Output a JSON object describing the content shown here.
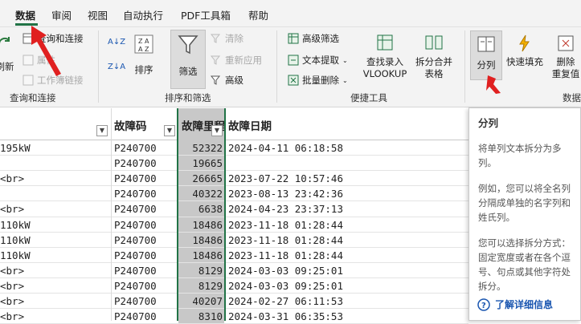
{
  "menu": {
    "tabs": [
      {
        "label": "数据",
        "active": true
      },
      {
        "label": "审阅"
      },
      {
        "label": "视图"
      },
      {
        "label": "自动执行"
      },
      {
        "label": "PDF工具箱"
      },
      {
        "label": "帮助"
      }
    ]
  },
  "ribbon": {
    "query_group": {
      "refresh_label": "刷新",
      "queries_connections_label": "查询和连接",
      "properties_label": "属性",
      "workbook_links_label": "工作簿链接",
      "group_label": "查询和连接"
    },
    "sort_filter_group": {
      "sort_az_label": "A↓Z",
      "sort_za_label": "Z↓A",
      "sort_label": "排序",
      "filter_label": "筛选",
      "clear_label": "清除",
      "reapply_label": "重新应用",
      "advanced_label": "高级",
      "group_label": "排序和筛选"
    },
    "tools_group": {
      "advanced_filter_label": "高级筛选",
      "text_extract_label": "文本提取",
      "batch_delete_label": "批量删除",
      "vlookup_label_line1": "查找录入",
      "vlookup_label_line2": "VLOOKUP",
      "split_merge_line1": "拆分合并",
      "split_merge_line2": "表格",
      "group_label": "便捷工具"
    },
    "data_tools_group": {
      "text_to_columns_label": "分列",
      "flash_fill_label": "快速填充",
      "remove_dup_line1": "删除",
      "remove_dup_line2": "重复值",
      "group_label": "数据"
    }
  },
  "sheet": {
    "headers": {
      "code": "故障码",
      "mileage": "故障里程",
      "date": "故障日期"
    },
    "rows": [
      {
        "a": "195kW",
        "code": "P240700",
        "mileage": "52322",
        "date": "2024-04-11  06:18:58"
      },
      {
        "a": "",
        "code": "P240700",
        "mileage": "19665",
        "date": ""
      },
      {
        "a": "<br>",
        "code": "P240700",
        "mileage": "26665",
        "date": "2023-07-22  10:57:46"
      },
      {
        "a": "",
        "code": "P240700",
        "mileage": "40322",
        "date": "2023-08-13  23:42:36"
      },
      {
        "a": "<br>",
        "code": "P240700",
        "mileage": "6638",
        "date": "2024-04-23  23:37:13"
      },
      {
        "a": "110kW",
        "code": "P240700",
        "mileage": "18486",
        "date": "2023-11-18  01:28:44"
      },
      {
        "a": "110kW",
        "code": "P240700",
        "mileage": "18486",
        "date": "2023-11-18  01:28:44"
      },
      {
        "a": "110kW",
        "code": "P240700",
        "mileage": "18486",
        "date": "2023-11-18  01:28:44"
      },
      {
        "a": "<br>",
        "code": "P240700",
        "mileage": "8129",
        "date": "2024-03-03  09:25:01"
      },
      {
        "a": "<br>",
        "code": "P240700",
        "mileage": "8129",
        "date": "2024-03-03  09:25:01"
      },
      {
        "a": "<br>",
        "code": "P240700",
        "mileage": "40207",
        "date": "2024-02-27  06:11:53"
      },
      {
        "a": "<br>",
        "code": "P240700",
        "mileage": "8310",
        "date": "2024-03-31  06:35:53"
      }
    ]
  },
  "tooltip": {
    "title": "分列",
    "p1": "将单列文本拆分为多列。",
    "p2": "例如，您可以将全名列分隔成单独的名字列和姓氏列。",
    "p3": "您可以选择拆分方式：固定宽度或者在各个逗号、句点或其他字符处拆分。",
    "link": "了解详细信息"
  },
  "colors": {
    "accent": "#217346",
    "selected_column": "#c8c8c8",
    "link": "#1a56b0",
    "arrow": "#e02020"
  }
}
